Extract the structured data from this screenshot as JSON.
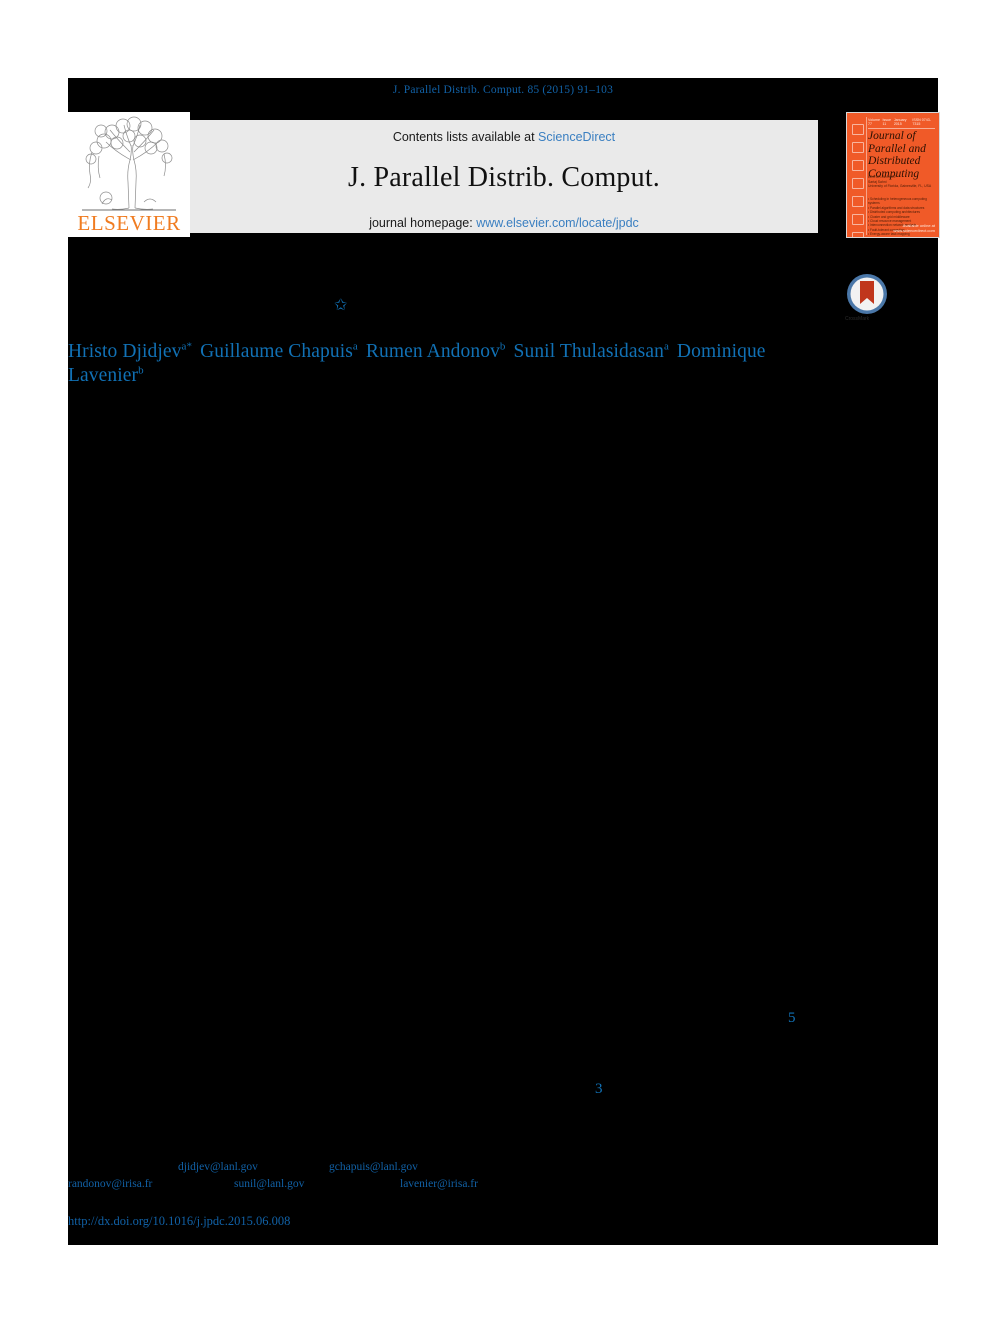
{
  "running_head": "J. Parallel Distrib. Comput. 85 (2015) 91–103",
  "masthead": {
    "contents_prefix": "Contents lists available at ",
    "contents_link": "ScienceDirect",
    "journal_title": "J. Parallel Distrib. Comput.",
    "homepage_prefix": "journal homepage: ",
    "homepage_link": "www.elsevier.com/locate/jpdc",
    "publisher_wordmark": "ELSEVIER",
    "publisher_logo_icon": "elsevier-tree-logo"
  },
  "journal_cover": {
    "title_line_1": "Journal of",
    "title_line_2": "Parallel and",
    "title_line_3": "Distributed",
    "title_line_4": "Computing",
    "top_volume": "Volume 77",
    "top_issue": "Issue 11",
    "top_date": "January 2015",
    "top_issn": "ISSN 0743-7315",
    "subtitle_block": "EDITOR-IN-CHIEF\nSartaj Sahni\nUniversity of Florida, Gainesville, FL, USA",
    "contents_block": "ASSOCIATE EDITORS\nSee inside front cover for full list\n\nSPECIAL ISSUE ON\nGraph Algorithms and Architectures",
    "list_block": "• Scheduling in heterogeneous computing systems\n• Parallel algorithms and data structures\n• Distributed computing architectures\n• Cluster and grid middleware\n• Cloud resource management\n• Interconnection network analysis\n• Fault-tolerant computing\n• Energy-aware task mapping\n• Performance evaluation of parallel systems\n• Multi-threaded programming models\n• GPU and many-core acceleration\n• Peer-to-peer networking",
    "footer": "Available online at www.sciencedirect.com",
    "color": "#f05a28"
  },
  "crossmark": {
    "icon": "crossmark-badge-icon",
    "label": "CrossMark"
  },
  "article": {
    "title_footnote_marker": "✩",
    "title_footnote_icon": "star-footnote-icon",
    "authors": [
      {
        "name": "Hristo Djidjev",
        "affiliation": "a",
        "corresponding": "*"
      },
      {
        "name": "Guillaume Chapuis",
        "affiliation": "a",
        "corresponding": ""
      },
      {
        "name": "Rumen Andonov",
        "affiliation": "b",
        "corresponding": ""
      },
      {
        "name": "Sunil Thulasidasan",
        "affiliation": "a",
        "corresponding": ""
      },
      {
        "name": "Dominique Lavenier",
        "affiliation": "b",
        "corresponding": ""
      }
    ]
  },
  "body_reference_numbers": [
    {
      "id": "5",
      "value": "5"
    },
    {
      "id": "3",
      "value": "3"
    }
  ],
  "footnote_emails": [
    "djidjev@lanl.gov",
    "gchapuis@lanl.gov",
    "randonov@irisa.fr",
    "sunil@lanl.gov",
    "lavenier@irisa.fr"
  ],
  "doi_url": "http://dx.doi.org/10.1016/j.jpdc.2015.06.008",
  "colors": {
    "link_blue": "#1161a6",
    "masthead_link_blue": "#3a7fc1",
    "elsevier_orange": "#f07c21",
    "cover_orange": "#f05a28",
    "masthead_grey": "#eaeaea",
    "redaction_black": "#000000"
  }
}
